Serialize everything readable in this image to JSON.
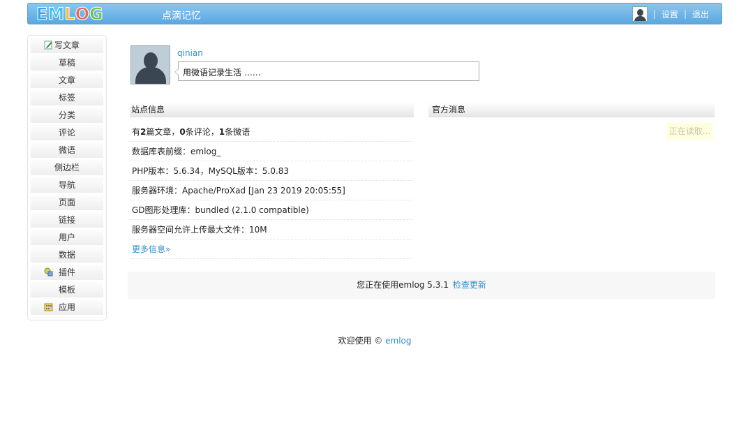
{
  "header": {
    "logo_letters": [
      "E",
      "M",
      "L",
      "O",
      "G"
    ],
    "logo_colors": [
      "#3aa0e8",
      "#3fb8e8",
      "#f2c12e",
      "#e86a5a",
      "#6cc24a"
    ],
    "site_title": "点滴记忆",
    "sep1": "|",
    "settings_label": "设置",
    "sep2": "|",
    "logout_label": "退出"
  },
  "sidebar": {
    "items": [
      {
        "label": "写文章",
        "icon": "write-icon"
      },
      {
        "label": "草稿"
      },
      {
        "label": "文章"
      },
      {
        "label": "标签"
      },
      {
        "label": "分类"
      },
      {
        "label": "评论"
      },
      {
        "label": "微语"
      },
      {
        "label": "侧边栏"
      },
      {
        "label": "导航"
      },
      {
        "label": "页面"
      },
      {
        "label": "链接"
      },
      {
        "label": "用户"
      },
      {
        "label": "数据"
      },
      {
        "label": "插件",
        "icon": "plugin-icon"
      },
      {
        "label": "模板"
      },
      {
        "label": "应用",
        "icon": "app-icon"
      }
    ]
  },
  "profile": {
    "username": "qinian",
    "twitter_placeholder": "用微语记录生活 ……"
  },
  "site_info": {
    "title": "站点信息",
    "stats": {
      "prefix": "有",
      "posts": "2",
      "posts_unit": "篇文章，",
      "comments": "0",
      "comments_unit": "条评论，",
      "twitters": "1",
      "twitters_unit": "条微语"
    },
    "rows": [
      "数据库表前缀：emlog_",
      "PHP版本：5.6.34，MySQL版本：5.0.83",
      "服务器环境：Apache/ProXad [Jan 23 2019 20:05:55]",
      "GD图形处理库：bundled (2.1.0 compatible)",
      "服务器空间允许上传最大文件：10M"
    ],
    "more_label": "更多信息»"
  },
  "news": {
    "title": "官方消息",
    "loading": "正在读取..."
  },
  "version": {
    "text": "您正在使用emlog 5.3.1",
    "check_label": "检查更新"
  },
  "footer": {
    "text": "欢迎使用 ©",
    "link": "emlog"
  }
}
